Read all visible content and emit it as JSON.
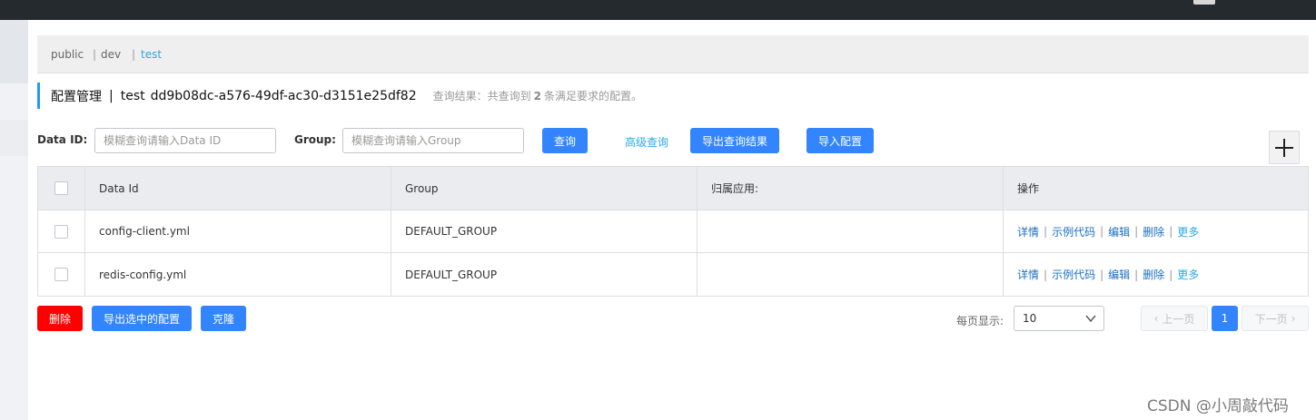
{
  "namespaces": [
    {
      "label": "public",
      "active": false
    },
    {
      "label": "dev",
      "active": false
    },
    {
      "label": "test",
      "active": true
    }
  ],
  "namespace_separator": "|",
  "title": {
    "main": "配置管理",
    "separator": "|",
    "namespace": "test",
    "namespace_id": "dd9b08dc-a576-49df-ac30-d3151e25df82",
    "result_prefix": "查询结果：共查询到",
    "result_count": "2",
    "result_suffix": "条满足要求的配置。"
  },
  "search": {
    "data_id_label": "Data ID:",
    "data_id_placeholder": "模糊查询请输入Data ID",
    "group_label": "Group:",
    "group_placeholder": "模糊查询请输入Group",
    "query_button": "查询",
    "advanced_query": "高级查询",
    "export_results_button": "导出查询结果",
    "import_button": "导入配置",
    "add_icon": "plus-icon"
  },
  "table": {
    "headers": [
      "Data Id",
      "Group",
      "归属应用:",
      "操作"
    ],
    "rows": [
      {
        "data_id": "config-client.yml",
        "group": "DEFAULT_GROUP",
        "app": ""
      },
      {
        "data_id": "redis-config.yml",
        "group": "DEFAULT_GROUP",
        "app": ""
      }
    ],
    "ops": {
      "detail": "详情",
      "sample": "示例代码",
      "edit": "编辑",
      "delete": "删除",
      "more": "更多",
      "sep": "|"
    }
  },
  "footer": {
    "delete_button": "删除",
    "export_selected_button": "导出选中的配置",
    "clone_button": "克隆",
    "page_size_label": "每页显示:",
    "page_size_value": "10",
    "prev_label": "上一页",
    "current_page": "1",
    "next_label": "下一页"
  },
  "colors": {
    "primary": "#3285ff",
    "link": "#29aae3",
    "danger": "#ff0000",
    "topbar": "#252a2f"
  },
  "watermark": "CSDN @小周敲代码"
}
